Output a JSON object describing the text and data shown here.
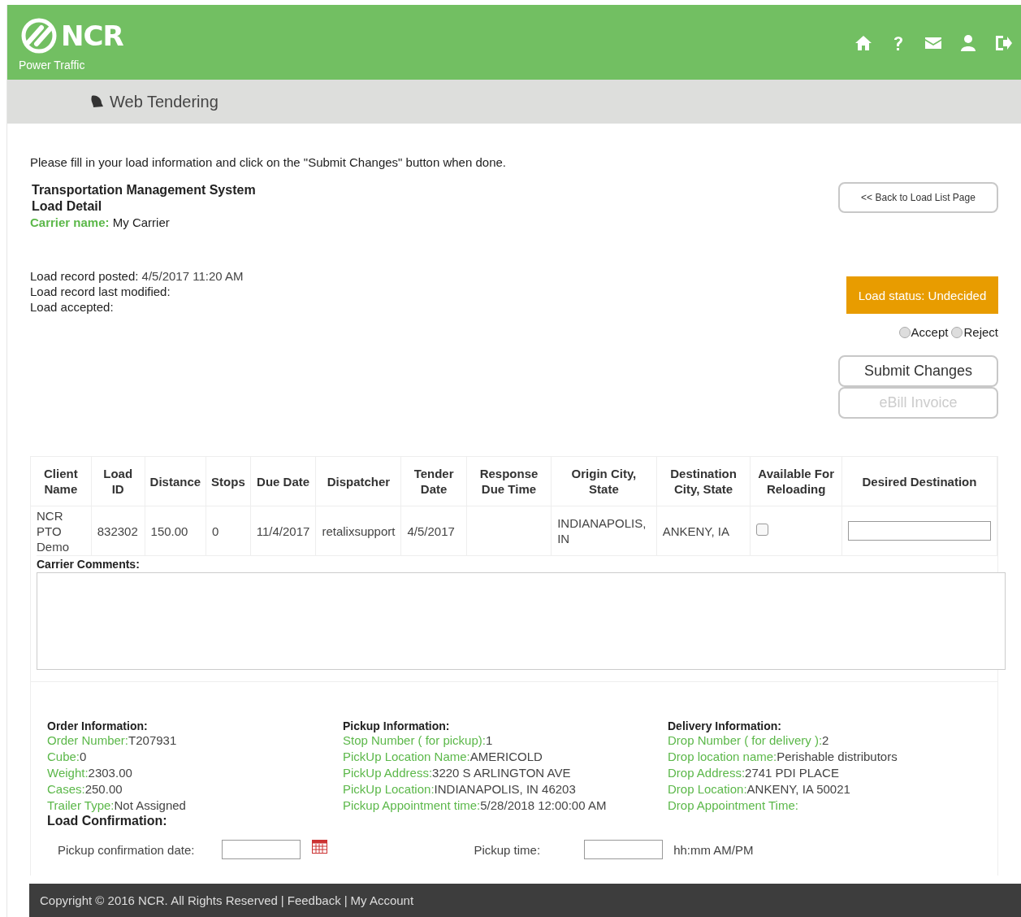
{
  "header": {
    "logo_text": "NCR",
    "subtitle": "Power Traffic"
  },
  "nav_bar": {
    "title": "Web Tendering"
  },
  "instructions": "Please fill in your load information and click on the \"Submit Changes\" button when done.",
  "headings": [
    "Transportation Management System",
    "Load Detail"
  ],
  "carrier_name": {
    "label": "Carrier name:",
    "value": "My Carrier"
  },
  "record_lines": [
    {
      "label": "Load record posted:",
      "value": "4/5/2017 11:20 AM"
    },
    {
      "label": "Load record last modified:"
    },
    {
      "label": "Load accepted:"
    }
  ],
  "back_button": "<< Back to Load List Page",
  "load_status": "Load status: Undecided",
  "decision": [
    {
      "label": "Accept",
      "selected": false
    },
    {
      "label": "Reject",
      "selected": false
    }
  ],
  "buttons": [
    {
      "label": "Submit Changes",
      "disabled": false
    },
    {
      "label": "eBill Invoice",
      "disabled": true
    }
  ],
  "table": {
    "columns": [
      "Client Name",
      "Load ID",
      "Distance",
      "Stops",
      "Due Date",
      "Dispatcher",
      "Tender Date",
      "Response Due Time",
      "Origin City, State",
      "Destination City, State",
      "Available For Reloading",
      "Desired Destination"
    ],
    "rows": [
      {
        "cells": [
          "NCR PTO Demo",
          "832302",
          "150.00",
          "0",
          "11/4/2017",
          "retalixsupport",
          "4/5/2017",
          null,
          "INDIANAPOLIS, IN",
          "ANKENY, IA"
        ],
        "available_for_reloading": false
      }
    ]
  },
  "carrier_comments": {
    "label": "Carrier Comments:"
  },
  "sections": [
    {
      "title": "Order Information:",
      "items": [
        {
          "label": "Order Number:",
          "value": "T207931"
        },
        {
          "label": "Cube:",
          "value": "0"
        },
        {
          "label": "Weight:",
          "value": "2303.00"
        },
        {
          "label": "Cases:",
          "value": "250.00"
        },
        {
          "label": "Trailer Type:",
          "value": "Not Assigned"
        }
      ]
    },
    {
      "title": "Pickup Information:",
      "items": [
        {
          "label": "Stop Number ( for pickup):",
          "value": "1"
        },
        {
          "label": "PickUp Location Name:",
          "value": "AMERICOLD"
        },
        {
          "label": "PickUp Address:",
          "value": "3220 S ARLINGTON AVE"
        },
        {
          "label": "PickUp Location:",
          "value": "INDIANAPOLIS, IN 46203"
        },
        {
          "label": "Pickup Appointment time:",
          "value": "5/28/2018 12:00:00 AM"
        }
      ]
    },
    {
      "title": "Delivery Information:",
      "items": [
        {
          "label": "Drop Number ( for delivery ):",
          "value": "2"
        },
        {
          "label": "Drop location name:",
          "value": "Perishable distributors"
        },
        {
          "label": "Drop Address:",
          "value": "2741 PDI PLACE"
        },
        {
          "label": "Drop Location:",
          "value": "ANKENY, IA 50021"
        },
        {
          "label": "Drop Appointment Time:"
        }
      ]
    }
  ],
  "load_confirmation": {
    "title": "Load Confirmation:",
    "date_label": "Pickup confirmation date:",
    "time_label": "Pickup time:",
    "time_hint": "hh:mm AM/PM"
  },
  "footer": {
    "copyright": "Copyright © 2016 NCR. All Rights Reserved",
    "separator_1": "|",
    "feedback": "Feedback",
    "separator_2": "|",
    "my_account": "My Account"
  }
}
